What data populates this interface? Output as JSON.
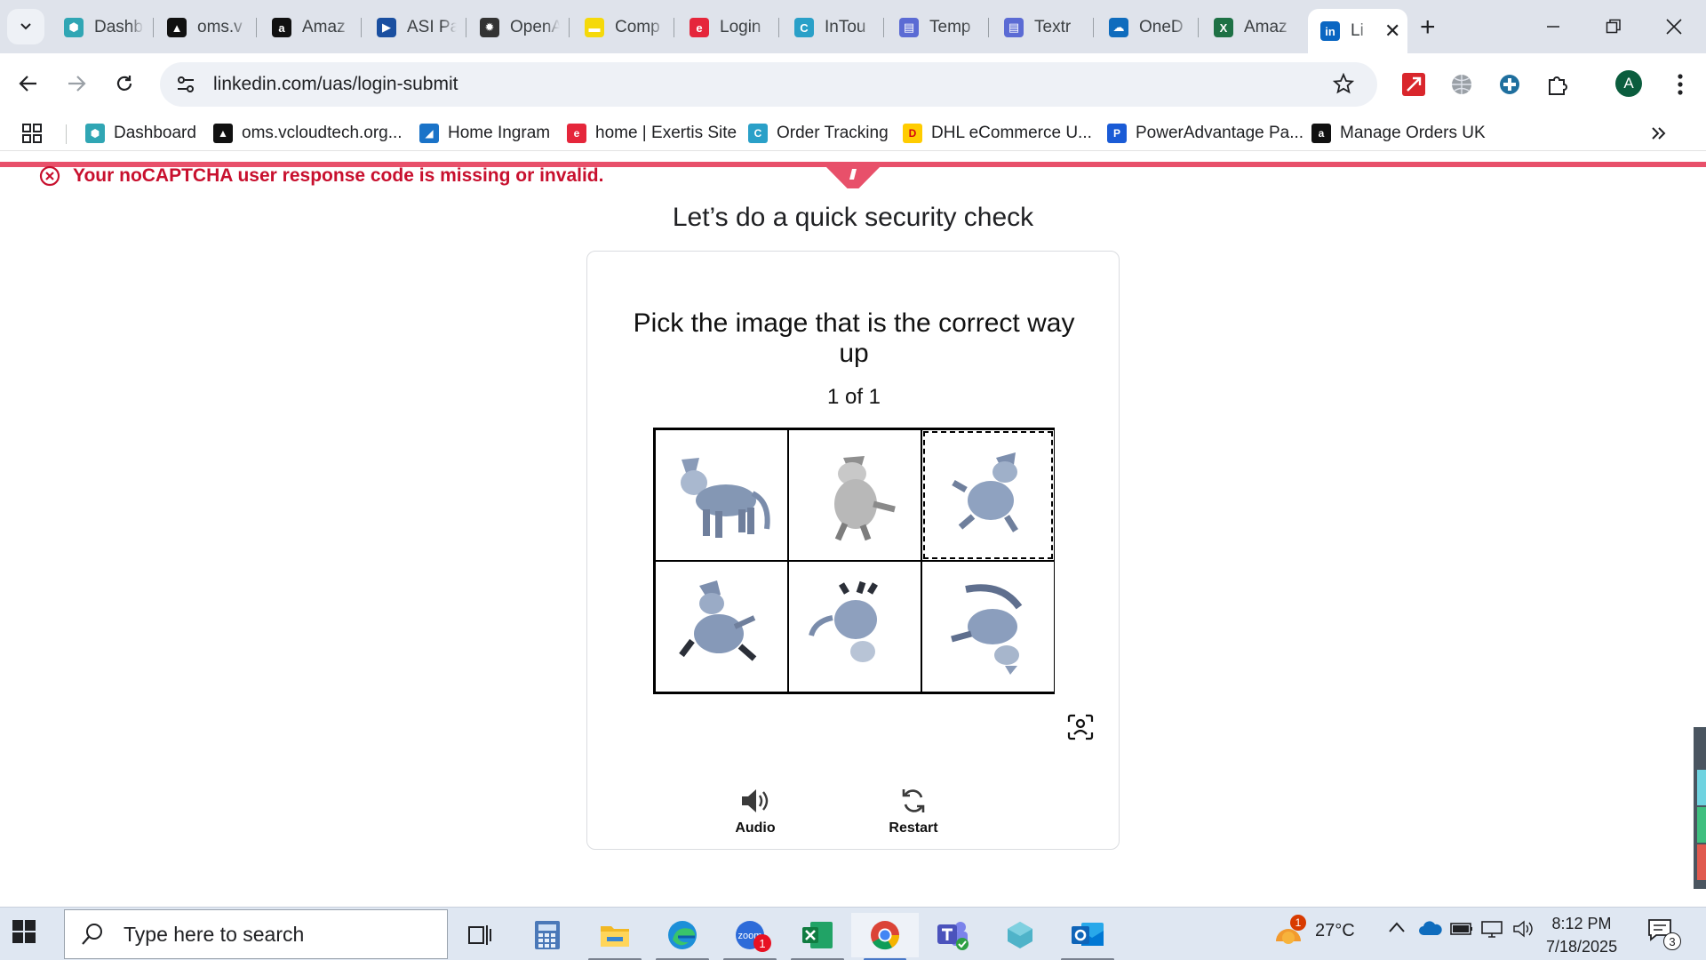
{
  "browser": {
    "tabs": [
      {
        "label": "Dashb",
        "icon": "hexagon-teal-icon",
        "color": "#30a6b4"
      },
      {
        "label": "oms.v",
        "icon": "triangle-black-icon",
        "color": "#111111"
      },
      {
        "label": "Amaz",
        "icon": "amazon-icon",
        "color": "#111111"
      },
      {
        "label": "ASI Pa",
        "icon": "arrow-play-icon",
        "color": "#1a4fa0"
      },
      {
        "label": "OpenA",
        "icon": "openai-icon",
        "color": "#333333"
      },
      {
        "label": "Comp",
        "icon": "yellow-card-icon",
        "color": "#f5d90a"
      },
      {
        "label": "Login",
        "icon": "exertis-icon",
        "color": "#e5263b"
      },
      {
        "label": "InTou",
        "icon": "intouch-icon",
        "color": "#2aa0c8"
      },
      {
        "label": "Temp",
        "icon": "doc-shield-icon",
        "color": "#5b6bd4"
      },
      {
        "label": "Textr",
        "icon": "doc-shield-icon",
        "color": "#5b6bd4"
      },
      {
        "label": "OneD",
        "icon": "cloud-icon",
        "color": "#0f6cbd"
      },
      {
        "label": "Amaz",
        "icon": "excel-icon",
        "color": "#1e7145"
      },
      {
        "label": "Li",
        "icon": "linkedin-icon",
        "color": "#0a66c2",
        "active": true
      }
    ],
    "url": "linkedin.com/uas/login-submit",
    "profile_initial": "A",
    "bookmarks": [
      {
        "label": "Dashboard",
        "icon": "hexagon-teal-icon",
        "color": "#30a6b4"
      },
      {
        "label": "oms.vcloudtech.org...",
        "icon": "triangle-black-icon",
        "color": "#111111"
      },
      {
        "label": "Home Ingram",
        "icon": "ingram-icon",
        "color": "#1a73c8"
      },
      {
        "label": "home | Exertis Site",
        "icon": "exertis-icon",
        "color": "#e5263b"
      },
      {
        "label": "Order Tracking",
        "icon": "intouch-icon",
        "color": "#2aa0c8"
      },
      {
        "label": "DHL eCommerce U...",
        "icon": "dhl-icon",
        "color": "#ffcc00"
      },
      {
        "label": "PowerAdvantage Pa...",
        "icon": "power-doc-icon",
        "color": "#1a5bd6"
      },
      {
        "label": "Manage Orders UK",
        "icon": "amazon-icon",
        "color": "#111111"
      }
    ]
  },
  "page": {
    "error_message": "Your noCAPTCHA user response code is missing or invalid.",
    "title": "Let’s do a quick security check",
    "instruction": "Pick the image that is the correct way up",
    "counter": "1 of 1",
    "audio_label": "Audio",
    "restart_label": "Restart",
    "accent_color": "#e8506a",
    "error_color": "#c8102e"
  },
  "taskbar": {
    "search_placeholder": "Type here to search",
    "weather": "27°C",
    "time": "8:12 PM",
    "date": "7/18/2025",
    "notification_count": "3",
    "zoom_badge": "1",
    "weather_badge": "1"
  }
}
